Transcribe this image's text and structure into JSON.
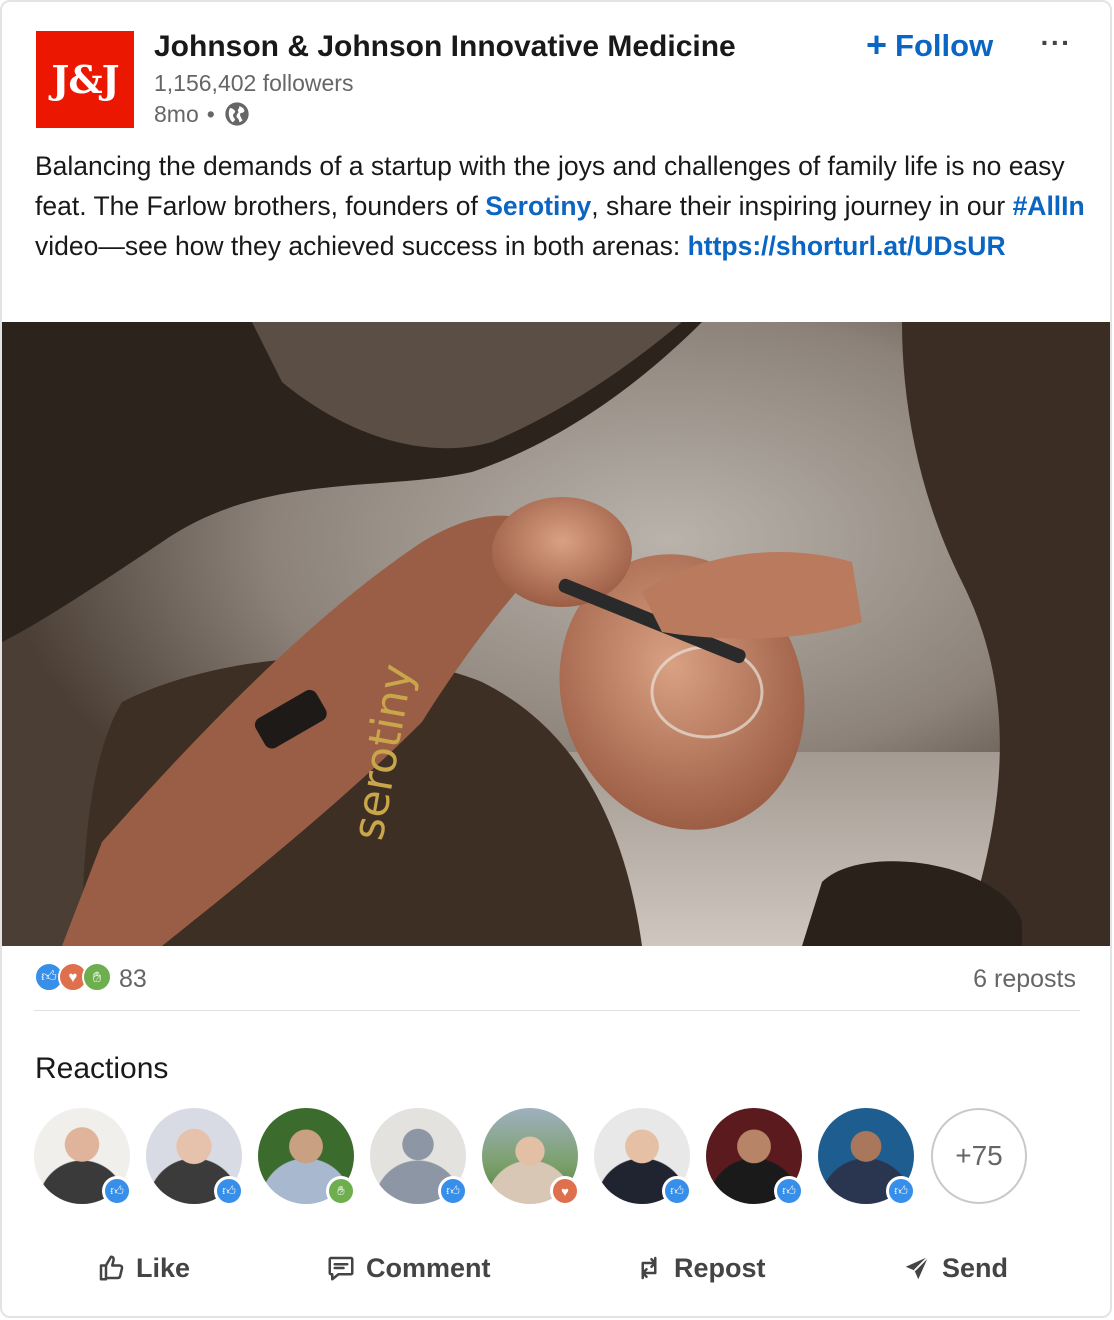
{
  "author": {
    "logo_text": "J&J",
    "name": "Johnson & Johnson Innovative Medicine",
    "followers": "1,156,402 followers",
    "age": "8mo",
    "separator": "•",
    "visibility_icon": "globe-icon"
  },
  "header_actions": {
    "follow_label": "Follow",
    "follow_icon": "+",
    "more_icon": "···"
  },
  "post": {
    "text_1": "Balancing the demands of a startup with the joys and challenges of family life is no easy feat. The Farlow brothers, founders of ",
    "mention": "Serotiny",
    "text_2": ", share their inspiring journey in our ",
    "hashtag": "#AllIn",
    "text_3": " video—see how they achieved success in both arenas: ",
    "link": "https://shorturl.at/UDsUR"
  },
  "social": {
    "reaction_count": "83",
    "reposts": "6 reposts",
    "reaction_types": [
      "like",
      "love",
      "support"
    ]
  },
  "reactions": {
    "title": "Reactions",
    "more": "+75",
    "people": [
      {
        "badge": "like"
      },
      {
        "badge": "like"
      },
      {
        "badge": "support"
      },
      {
        "badge": "like"
      },
      {
        "badge": "love"
      },
      {
        "badge": "like"
      },
      {
        "badge": "like"
      },
      {
        "badge": "like"
      }
    ]
  },
  "actions": {
    "like": "Like",
    "comment": "Comment",
    "repost": "Repost",
    "send": "Send"
  },
  "colors": {
    "brand_red": "#eb1700",
    "link_blue": "#0a66c2",
    "like_blue": "#378fe9",
    "love_orange": "#df704d",
    "support_green": "#6dae4f"
  }
}
